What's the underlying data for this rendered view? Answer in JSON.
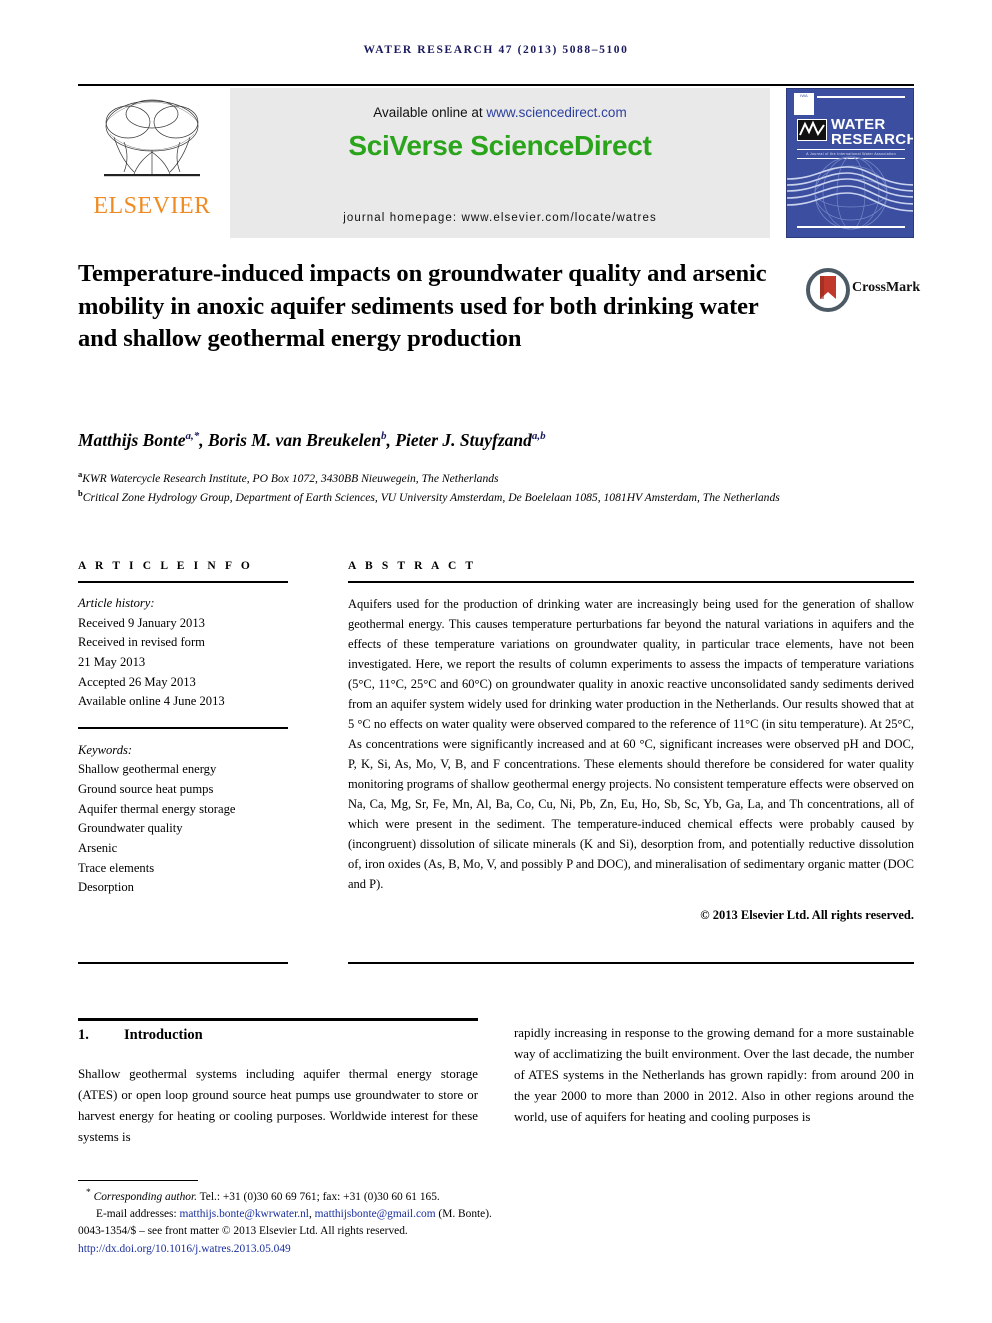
{
  "running_head": "WATER RESEARCH 47 (2013) 5088–5100",
  "masthead": {
    "publisher_name": "ELSEVIER",
    "available_prefix": "Available online at ",
    "available_url": "www.sciencedirect.com",
    "platform_logo": "SciVerse ScienceDirect",
    "journal_homepage": "journal homepage: www.elsevier.com/locate/watres",
    "cover": {
      "title_line1": "WATER",
      "title_line2": "RESEARCH",
      "subtitle": "A Journal of the International Water Association",
      "society_mark": "IWA"
    }
  },
  "article": {
    "title": "Temperature-induced impacts on groundwater quality and arsenic mobility in anoxic aquifer sediments used for both drinking water and shallow geothermal energy production",
    "crossmark_label": "CrossMark",
    "authors_html": "Matthijs Bonte<sup>a,*</sup>, Boris M. van Breukelen<sup>b</sup>, Pieter J. Stuyfzand<sup>a,b</sup>",
    "affiliation_a": "KWR Watercycle Research Institute, PO Box 1072, 3430BB Nieuwegein, The Netherlands",
    "affiliation_b": "Critical Zone Hydrology Group, Department of Earth Sciences, VU University Amsterdam, De Boelelaan 1085, 1081HV Amsterdam, The Netherlands"
  },
  "article_info": {
    "heading": "A R T I C L E   I N F O",
    "history_label": "Article history:",
    "history": [
      "Received 9 January 2013",
      "Received in revised form",
      "21 May 2013",
      "Accepted 26 May 2013",
      "Available online 4 June 2013"
    ],
    "keywords_label": "Keywords:",
    "keywords": [
      "Shallow geothermal energy",
      "Ground source heat pumps",
      "Aquifer thermal energy storage",
      "Groundwater quality",
      "Arsenic",
      "Trace elements",
      "Desorption"
    ]
  },
  "abstract": {
    "heading": "A B S T R A C T",
    "text": "Aquifers used for the production of drinking water are increasingly being used for the generation of shallow geothermal energy. This causes temperature perturbations far beyond the natural variations in aquifers and the effects of these temperature variations on groundwater quality, in particular trace elements, have not been investigated. Here, we report the results of column experiments to assess the impacts of temperature variations (5°C, 11°C, 25°C and 60°C) on groundwater quality in anoxic reactive unconsolidated sandy sediments derived from an aquifer system widely used for drinking water production in the Netherlands. Our results showed that at 5 °C no effects on water quality were observed compared to the reference of 11°C (in situ temperature). At 25°C, As concentrations were significantly increased and at 60 °C, significant increases were observed pH and DOC, P, K, Si, As, Mo, V, B, and F concentrations. These elements should therefore be considered for water quality monitoring programs of shallow geothermal energy projects. No consistent temperature effects were observed on Na, Ca, Mg, Sr, Fe, Mn, Al, Ba, Co, Cu, Ni, Pb, Zn, Eu, Ho, Sb, Sc, Yb, Ga, La, and Th concentrations, all of which were present in the sediment. The temperature-induced chemical effects were probably caused by (incongruent) dissolution of silicate minerals (K and Si), desorption from, and potentially reductive dissolution of, iron oxides (As, B, Mo, V, and possibly P and DOC), and mineralisation of sedimentary organic matter (DOC and P).",
    "copyright": "© 2013 Elsevier Ltd. All rights reserved."
  },
  "body": {
    "section_number": "1.",
    "section_title": "Introduction",
    "left_column": "Shallow geothermal systems including aquifer thermal energy storage (ATES) or open loop ground source heat pumps use groundwater to store or harvest energy for heating or cooling purposes. Worldwide interest for these systems is",
    "right_column": "rapidly increasing in response to the growing demand for a more sustainable way of acclimatizing the built environment. Over the last decade, the number of ATES systems in the Netherlands has grown rapidly: from around 200 in the year 2000 to more than 2000 in 2012. Also in other regions around the world, use of aquifers for heating and cooling purposes is"
  },
  "footnote": {
    "corresponding_label": "Corresponding author.",
    "corresponding_contact": " Tel.: +31 (0)30 60 69 761; fax: +31 (0)30 60 61 165.",
    "email_label": "E-mail addresses: ",
    "email1": "matthijs.bonte@kwrwater.nl",
    "email_sep": ", ",
    "email2": "matthijsbonte@gmail.com",
    "email_suffix": " (M. Bonte).",
    "issn_line": "0043-1354/$ – see front matter © 2013 Elsevier Ltd. All rights reserved.",
    "doi": "http://dx.doi.org/10.1016/j.watres.2013.05.049"
  },
  "colors": {
    "link_blue": "#1a2f9e",
    "sciencedirect_green": "#2aa51b",
    "elsevier_orange": "#f08a22",
    "cover_blue": "#3b4ea0",
    "runhead_navy": "#1a1a5e"
  }
}
